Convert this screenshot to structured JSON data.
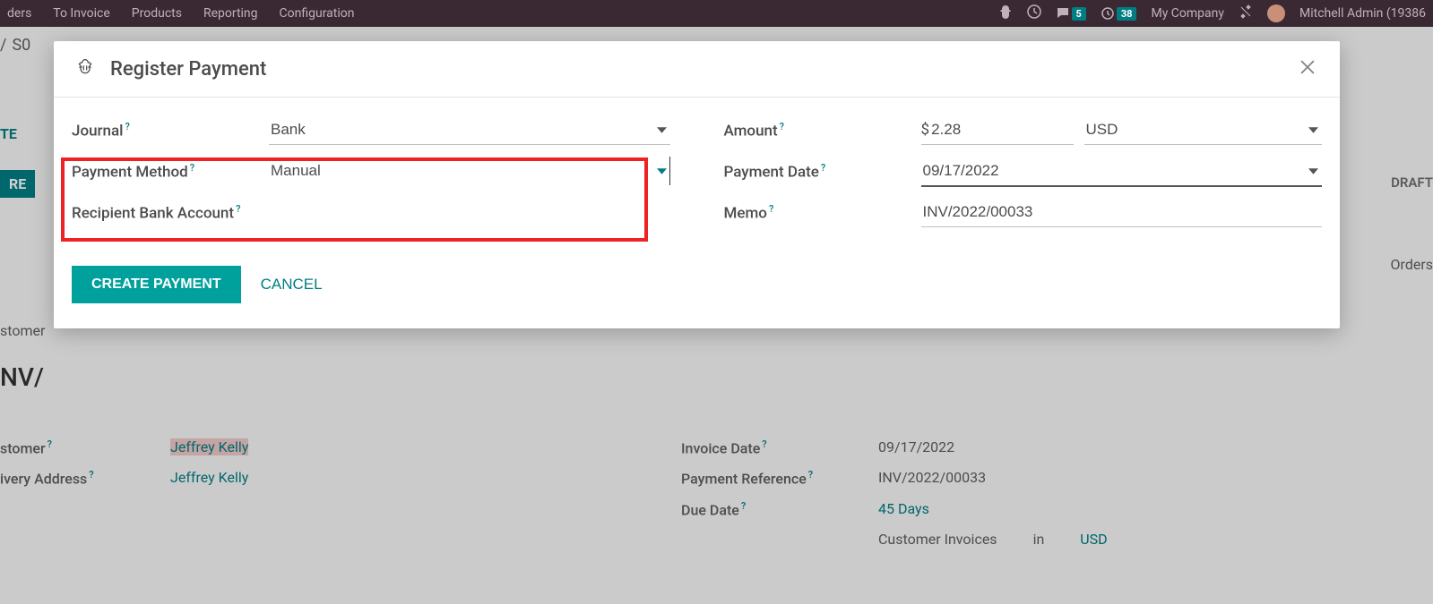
{
  "topnav": {
    "items": [
      "ders",
      "To Invoice",
      "Products",
      "Reporting",
      "Configuration"
    ],
    "messages_badge": "5",
    "activities_badge": "38",
    "company": "My Company",
    "user": "Mitchell Admin (19386"
  },
  "background": {
    "breadcrumb_sep": "/",
    "breadcrumb_1": "S0",
    "te": "TE",
    "re": "RE",
    "draft": "DRAFT",
    "orders": "Orders",
    "inv_prefix": "NV/",
    "customer_label": "stomer",
    "customer_label2": "stomer",
    "delivery_label": "ivery Address",
    "customer_link": "Jeffrey Kelly",
    "delivery_link": "Jeffrey Kelly",
    "invoice_date_label": "Invoice Date",
    "invoice_date": "09/17/2022",
    "payment_ref_label": "Payment Reference",
    "payment_ref": "INV/2022/00033",
    "due_date_label": "Due Date",
    "due_date": "45 Days",
    "journal_type": "Customer Invoices",
    "in_word": "in",
    "journal_currency": "USD"
  },
  "modal": {
    "title": "Register Payment",
    "journal_label": "Journal",
    "journal_value": "Bank",
    "payment_method_label": "Payment Method",
    "payment_method_value": "Manual",
    "recipient_bank_label": "Recipient Bank Account",
    "amount_label": "Amount",
    "amount_currency_symbol": "$",
    "amount_value": "2.28",
    "currency_value": "USD",
    "payment_date_label": "Payment Date",
    "payment_date_value": "09/17/2022",
    "memo_label": "Memo",
    "memo_value": "INV/2022/00033",
    "create_btn": "CREATE PAYMENT",
    "cancel_btn": "CANCEL"
  }
}
